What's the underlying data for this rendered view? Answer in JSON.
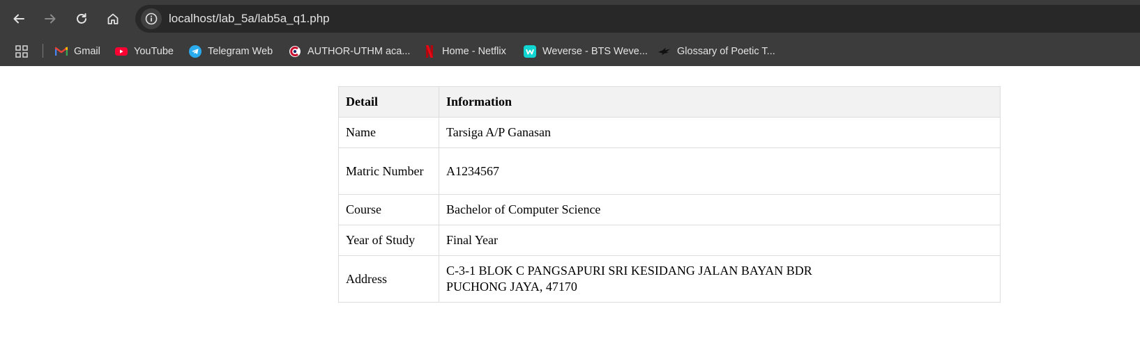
{
  "browser": {
    "url": "localhost/lab_5a/lab5a_q1.php",
    "nav_icons": [
      "back-arrow-icon",
      "forward-arrow-icon",
      "reload-icon",
      "home-icon",
      "site-info-icon"
    ],
    "bookmarks": [
      {
        "label": "Gmail",
        "icon": "gmail-icon"
      },
      {
        "label": "YouTube",
        "icon": "youtube-icon"
      },
      {
        "label": "Telegram Web",
        "icon": "telegram-icon"
      },
      {
        "label": "AUTHOR-UTHM aca...",
        "icon": "uthm-icon"
      },
      {
        "label": "Home - Netflix",
        "icon": "netflix-icon"
      },
      {
        "label": "Weverse - BTS Weve...",
        "icon": "weverse-icon"
      },
      {
        "label": "Glossary of Poetic T...",
        "icon": "bird-icon"
      }
    ]
  },
  "table": {
    "headers": [
      "Detail",
      "Information"
    ],
    "rows": [
      {
        "detail": "Name",
        "info": "Tarsiga A/P Ganasan"
      },
      {
        "detail": "Matric Number",
        "info": "A1234567"
      },
      {
        "detail": "Course",
        "info": "Bachelor of Computer Science"
      },
      {
        "detail": "Year of Study",
        "info": "Final Year"
      },
      {
        "detail": "Address",
        "info": "C-3-1 BLOK C PANGSAPURI SRI KESIDANG JALAN BAYAN BDR PUCHONG JAYA, 47170"
      }
    ]
  },
  "colors": {
    "toolbar_bg": "#3c3c3c",
    "omnibox_bg": "#282828",
    "header_bg": "#f2f2f2",
    "border": "#dddddd"
  }
}
